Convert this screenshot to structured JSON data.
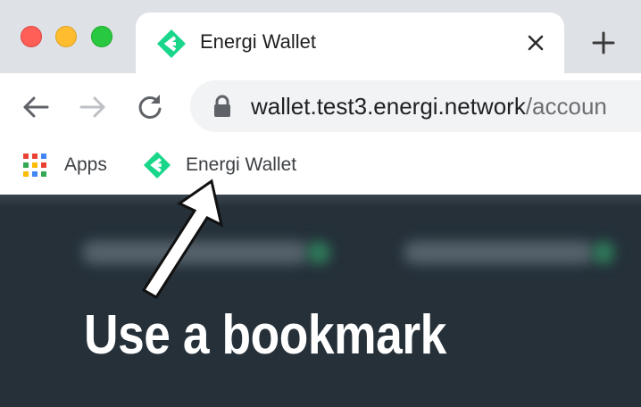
{
  "window": {
    "controls": [
      "close",
      "minimize",
      "maximize"
    ]
  },
  "tab": {
    "title": "Energi Wallet",
    "favicon": "energi-logo",
    "close_icon": "close-icon",
    "new_tab_icon": "plus-icon"
  },
  "toolbar": {
    "back_icon": "arrow-left-icon",
    "forward_icon": "arrow-right-icon",
    "reload_icon": "reload-icon",
    "lock_icon": "lock-icon",
    "url_host": "wallet.test3.energi.network",
    "url_path": "/accoun"
  },
  "bookmarks": {
    "items": [
      {
        "label": "Apps",
        "icon": "apps-grid-icon"
      },
      {
        "label": "Energi Wallet",
        "icon": "energi-logo"
      }
    ]
  },
  "page": {
    "caption": "Use a bookmark"
  },
  "colors": {
    "energi_green": "#19d68a",
    "page_background": "#253039",
    "tab_strip": "#dee1e6",
    "omnibox": "#f1f3f4"
  }
}
